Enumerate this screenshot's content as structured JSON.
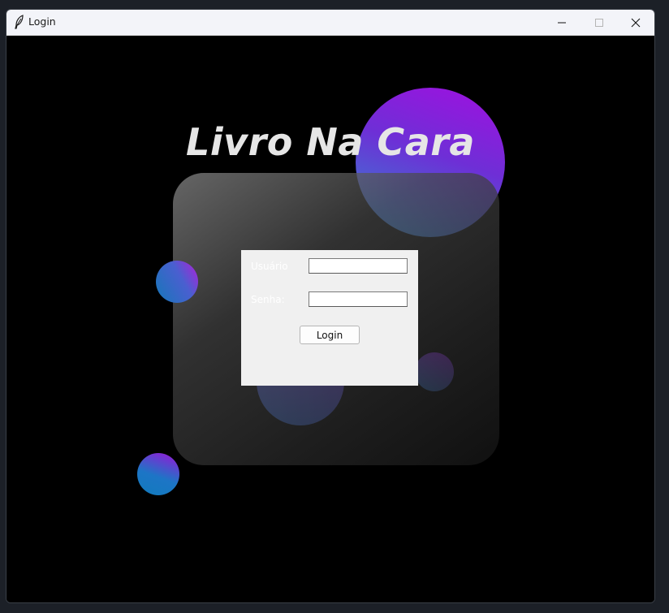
{
  "window": {
    "title": "Login",
    "icon": "feather-icon",
    "controls": [
      "minimize-icon",
      "maximize-icon",
      "close-icon"
    ]
  },
  "app": {
    "title": "Livro Na Cara"
  },
  "form": {
    "username_label": "Usuário",
    "username_value": "",
    "password_label": "Senha:",
    "password_value": "",
    "login_button": "Login"
  },
  "colors": {
    "background": "#000000",
    "title_text": "#e6e6e6",
    "form_bg": "#f0f0f0",
    "accent_purple": "#a10fe0",
    "accent_blue": "#1d75c6"
  }
}
